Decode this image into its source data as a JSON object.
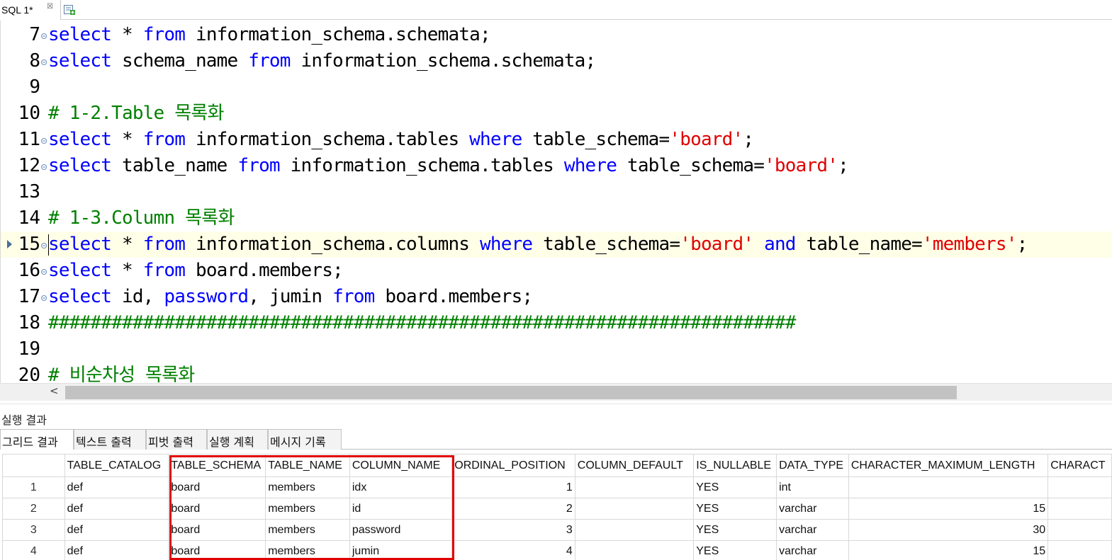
{
  "tab": {
    "label": "SQL 1*",
    "close_glyph": "☒",
    "new_icon": "new-query-icon"
  },
  "editor": {
    "lines": [
      {
        "num": "7",
        "tokens": [
          [
            "kw",
            "select"
          ],
          [
            "t",
            " * "
          ],
          [
            "kw",
            "from"
          ],
          [
            "t",
            " information_schema.schemata;"
          ]
        ]
      },
      {
        "num": "8",
        "tokens": [
          [
            "kw",
            "select"
          ],
          [
            "t",
            " schema_name "
          ],
          [
            "kw",
            "from"
          ],
          [
            "t",
            " information_schema.schemata;"
          ]
        ]
      },
      {
        "num": "9",
        "tokens": []
      },
      {
        "num": "10",
        "tokens": [
          [
            "cmt",
            "# 1-2.Table 목록화"
          ]
        ]
      },
      {
        "num": "11",
        "tokens": [
          [
            "kw",
            "select"
          ],
          [
            "t",
            " * "
          ],
          [
            "kw",
            "from"
          ],
          [
            "t",
            " information_schema.tables "
          ],
          [
            "kw",
            "where"
          ],
          [
            "t",
            " table_schema="
          ],
          [
            "str",
            "'board'"
          ],
          [
            "t",
            ";"
          ]
        ]
      },
      {
        "num": "12",
        "tokens": [
          [
            "kw",
            "select"
          ],
          [
            "t",
            " table_name "
          ],
          [
            "kw",
            "from"
          ],
          [
            "t",
            " information_schema.tables "
          ],
          [
            "kw",
            "where"
          ],
          [
            "t",
            " table_schema="
          ],
          [
            "str",
            "'board'"
          ],
          [
            "t",
            ";"
          ]
        ]
      },
      {
        "num": "13",
        "tokens": []
      },
      {
        "num": "14",
        "tokens": [
          [
            "cmt",
            "# 1-3.Column 목록화"
          ]
        ]
      },
      {
        "num": "15",
        "current": true,
        "tokens": [
          [
            "kw",
            "select"
          ],
          [
            "t",
            " * "
          ],
          [
            "kw",
            "from"
          ],
          [
            "t",
            " information_schema.columns "
          ],
          [
            "kw",
            "where"
          ],
          [
            "t",
            " table_schema="
          ],
          [
            "str",
            "'board'"
          ],
          [
            "t",
            " "
          ],
          [
            "kw",
            "and"
          ],
          [
            "t",
            " table_name="
          ],
          [
            "str",
            "'members'"
          ],
          [
            "t",
            ";"
          ]
        ]
      },
      {
        "num": "16",
        "tokens": [
          [
            "kw",
            "select"
          ],
          [
            "t",
            " * "
          ],
          [
            "kw",
            "from"
          ],
          [
            "t",
            " board.members;"
          ]
        ]
      },
      {
        "num": "17",
        "tokens": [
          [
            "kw",
            "select"
          ],
          [
            "t",
            " id, "
          ],
          [
            "kw",
            "password"
          ],
          [
            "t",
            ", jumin "
          ],
          [
            "kw",
            "from"
          ],
          [
            "t",
            " board.members;"
          ]
        ]
      },
      {
        "num": "18",
        "tokens": [
          [
            "cmt",
            "#######################################################################"
          ]
        ]
      },
      {
        "num": "19",
        "tokens": []
      },
      {
        "num": "20",
        "tokens": [
          [
            "cmt",
            "# 비순차성 목록화"
          ]
        ]
      }
    ]
  },
  "scrollbar": {
    "left_arrow": "<"
  },
  "results": {
    "title": "실행 결과",
    "tabs": [
      "그리드 결과",
      "텍스트 출력",
      "피벗 출력",
      "실행 계획",
      "메시지 기록"
    ],
    "active_tab": 0,
    "columns": [
      "",
      "TABLE_CATALOG",
      "TABLE_SCHEMA",
      "TABLE_NAME",
      "COLUMN_NAME",
      "ORDINAL_POSITION",
      "COLUMN_DEFAULT",
      "IS_NULLABLE",
      "DATA_TYPE",
      "CHARACTER_MAXIMUM_LENGTH",
      "CHARACT"
    ],
    "rows": [
      [
        "1",
        "def",
        "board",
        "members",
        "idx",
        "1",
        "",
        "YES",
        "int",
        "",
        ""
      ],
      [
        "2",
        "def",
        "board",
        "members",
        "id",
        "2",
        "",
        "YES",
        "varchar",
        "15",
        ""
      ],
      [
        "3",
        "def",
        "board",
        "members",
        "password",
        "3",
        "",
        "YES",
        "varchar",
        "30",
        ""
      ],
      [
        "4",
        "def",
        "board",
        "members",
        "jumin",
        "4",
        "",
        "YES",
        "varchar",
        "15",
        ""
      ]
    ],
    "highlight_color": "#e00000"
  }
}
